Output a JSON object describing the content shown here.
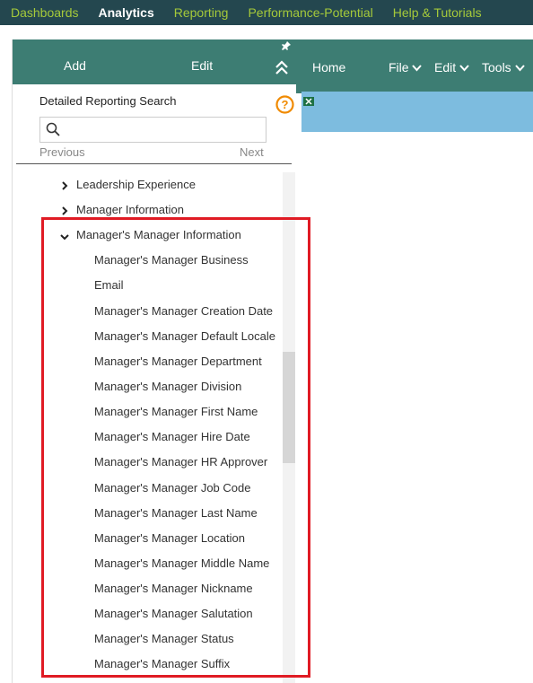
{
  "topnav": {
    "items": [
      "Dashboards",
      "Analytics",
      "Reporting",
      "Performance-Potential",
      "Help & Tutorials"
    ],
    "active": "Analytics"
  },
  "leftpanel": {
    "tabs": {
      "add": "Add",
      "edit": "Edit"
    },
    "search": {
      "label": "Detailed Reporting Search",
      "placeholder": "",
      "prev": "Previous",
      "next": "Next"
    },
    "tree": {
      "collapsed": [
        "Leadership Experience",
        "Manager Information"
      ],
      "expanded": "Manager's Manager Information",
      "children": [
        "Manager's Manager Business",
        "Email",
        "Manager's Manager Creation Date",
        "Manager's Manager Default Locale",
        "Manager's Manager Department",
        "Manager's Manager Division",
        "Manager's Manager First Name",
        "Manager's Manager Hire Date",
        "Manager's Manager HR Approver",
        "Manager's Manager Job Code",
        "Manager's Manager Last Name",
        "Manager's Manager Location",
        "Manager's Manager Middle Name",
        "Manager's Manager Nickname",
        "Manager's Manager Salutation",
        "Manager's Manager Status",
        "Manager's Manager Suffix"
      ]
    }
  },
  "rightpanel": {
    "menu": {
      "home": "Home",
      "file": "File",
      "edit": "Edit",
      "tools": "Tools"
    }
  },
  "colors": {
    "nav_bg": "#24474f",
    "nav_link": "#a5c93a",
    "header_bg": "#3d7d73",
    "banner": "#7dbcdf",
    "highlight": "#e01b24",
    "help": "#f08a00"
  }
}
